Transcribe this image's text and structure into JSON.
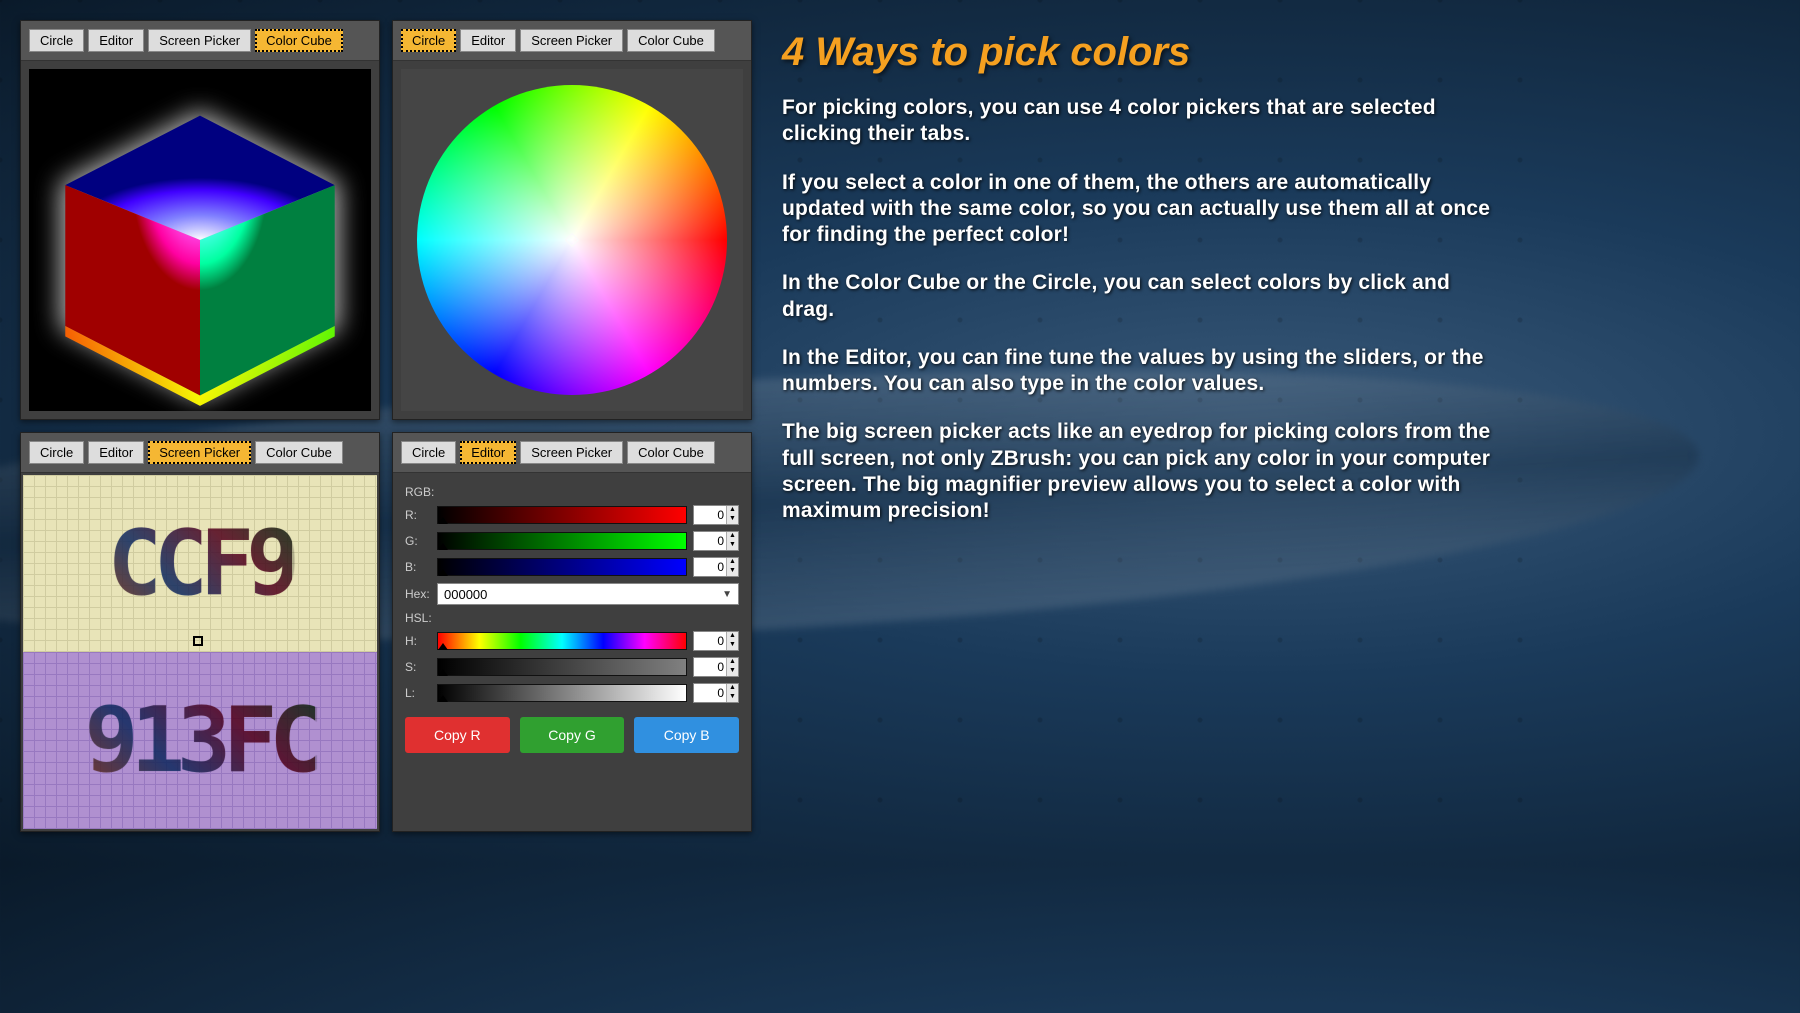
{
  "tabs": {
    "circle": "Circle",
    "editor": "Editor",
    "screen_picker": "Screen Picker",
    "color_cube": "Color Cube"
  },
  "editor": {
    "rgb_label": "RGB:",
    "r_label": "R:",
    "g_label": "G:",
    "b_label": "B:",
    "hex_label": "Hex:",
    "hex_value": "000000",
    "hsl_label": "HSL:",
    "h_label": "H:",
    "s_label": "S:",
    "l_label": "L:",
    "r_value": "0",
    "g_value": "0",
    "b_value": "0",
    "h_value": "0",
    "s_value": "0",
    "l_value": "0",
    "copy_r": "Copy R",
    "copy_g": "Copy G",
    "copy_b": "Copy B"
  },
  "screen_picker": {
    "sample_top": "CCF9",
    "sample_bottom": "913FC"
  },
  "text": {
    "headline": "4 Ways to pick colors",
    "p1": "For picking colors, you can use 4 color pickers that are selected clicking their tabs.",
    "p2": "If you select a color in one of them, the others are automatically updated with the same color, so you can actually use them all at once for finding the perfect color!",
    "p3": "In the Color Cube or the Circle, you can select colors by click and drag.",
    "p4": "In the Editor, you can fine tune the values by using the sliders, or the numbers. You can also type in the color values.",
    "p5": "The big screen picker acts like an eyedrop for picking colors from the full screen, not only ZBrush: you can pick any color in your computer screen. The big magnifier preview allows you to select a color with maximum precision!"
  }
}
